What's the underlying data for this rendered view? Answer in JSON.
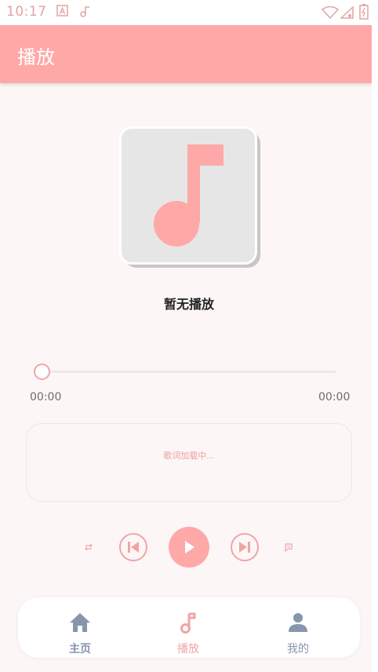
{
  "status_bar": {
    "time": "10:17"
  },
  "app_bar": {
    "title": "播放"
  },
  "player": {
    "song_title": "暂无播放",
    "progress_fraction": 0,
    "current_time": "00:00",
    "total_time": "00:00",
    "lyrics_placeholder": "歌词加载中..."
  },
  "bottom_nav": {
    "items": [
      {
        "label": "主页",
        "icon": "home-icon",
        "active": false
      },
      {
        "label": "播放",
        "icon": "music-note-icon",
        "active": true
      },
      {
        "label": "我的",
        "icon": "person-icon",
        "active": false
      }
    ]
  },
  "colors": {
    "accent": "#ffa8a8",
    "accent_dark": "#f0a5a5",
    "nav_inactive": "#8795ad",
    "background": "#fdf6f6"
  }
}
